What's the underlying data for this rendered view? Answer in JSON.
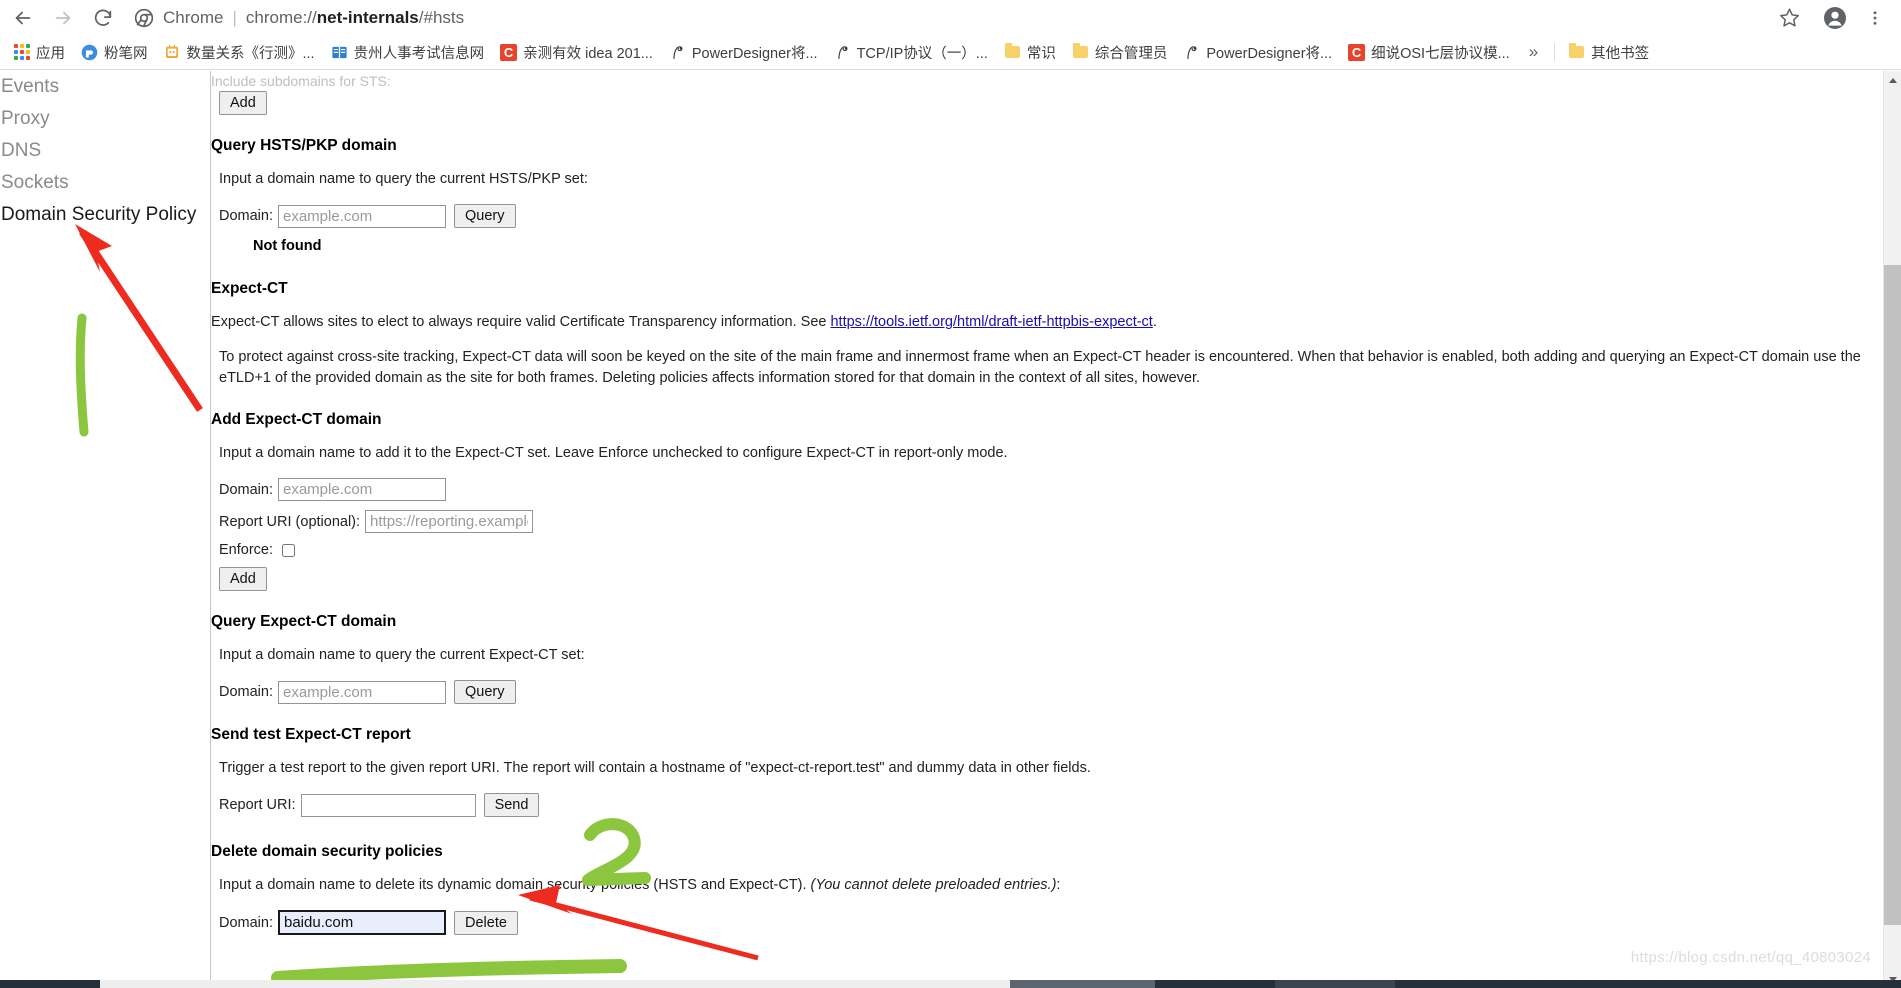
{
  "browser": {
    "nav": {
      "back_icon": "arrow-left-icon",
      "forward_icon": "arrow-right-icon",
      "reload_icon": "reload-icon"
    },
    "omnibox": {
      "chrome_icon": "chrome-icon",
      "chrome_label": "Chrome",
      "separator": "|",
      "url_prefix": "chrome://",
      "url_host": "net-internals",
      "url_suffix": "/#hsts",
      "full_url": "chrome://net-internals/#hsts"
    },
    "toolbar_icons": {
      "star": "star-icon",
      "avatar": "profile-avatar-icon",
      "menu": "three-dot-menu-icon"
    },
    "bookmarks": [
      {
        "label": "应用",
        "icon": "apps-grid-icon"
      },
      {
        "label": "粉笔网",
        "icon": "fenbi-icon"
      },
      {
        "label": "数量关系《行测》...",
        "icon": "book-icon"
      },
      {
        "label": "贵州人事考试信息网",
        "icon": "book-blue-icon"
      },
      {
        "label": "亲测有效 idea 201...",
        "icon": "csdn-c-icon"
      },
      {
        "label": "PowerDesigner将...",
        "icon": "pd-icon"
      },
      {
        "label": "TCP/IP协议（一）...",
        "icon": "pd-icon"
      },
      {
        "label": "常识",
        "icon": "folder-icon"
      },
      {
        "label": "综合管理员",
        "icon": "folder-icon"
      },
      {
        "label": "PowerDesigner将...",
        "icon": "pd-icon"
      },
      {
        "label": "细说OSI七层协议模...",
        "icon": "csdn-c-icon"
      }
    ],
    "bookmarks_overflow": "»",
    "other_bookmarks": {
      "label": "其他书签",
      "icon": "folder-icon"
    }
  },
  "sidebar": {
    "items": [
      {
        "label": "Events",
        "active": false
      },
      {
        "label": "Proxy",
        "active": false
      },
      {
        "label": "DNS",
        "active": false
      },
      {
        "label": "Sockets",
        "active": false
      },
      {
        "label": "Domain Security Policy",
        "active": true
      }
    ]
  },
  "main": {
    "cut_off_line": "Include subdomains for STS:",
    "add_sts_button": "Add",
    "query_hsts": {
      "heading": "Query HSTS/PKP domain",
      "description": "Input a domain name to query the current HSTS/PKP set:",
      "domain_label": "Domain:",
      "domain_placeholder": "example.com",
      "domain_value": "",
      "query_button": "Query",
      "result": "Not found"
    },
    "expect_ct": {
      "heading": "Expect-CT",
      "para1_before_link": "Expect-CT allows sites to elect to always require valid Certificate Transparency information. See ",
      "para1_link": "https://tools.ietf.org/html/draft-ietf-httpbis-expect-ct",
      "para1_after_link": ".",
      "para2": "To protect against cross-site tracking, Expect-CT data will soon be keyed on the site of the main frame and innermost frame when an Expect-CT header is encountered. When that behavior is enabled, both adding and querying an Expect-CT domain use the eTLD+1 of the provided domain as the site for both frames. Deleting policies affects information stored for that domain in the context of all sites, however."
    },
    "add_expect_ct": {
      "heading": "Add Expect-CT domain",
      "description": "Input a domain name to add it to the Expect-CT set. Leave Enforce unchecked to configure Expect-CT in report-only mode.",
      "domain_label": "Domain:",
      "domain_placeholder": "example.com",
      "domain_value": "",
      "report_uri_label": "Report URI (optional):",
      "report_uri_placeholder": "https://reporting.example.c",
      "report_uri_value": "",
      "enforce_label": "Enforce:",
      "enforce_checked": false,
      "add_button": "Add"
    },
    "query_expect_ct": {
      "heading": "Query Expect-CT domain",
      "description": "Input a domain name to query the current Expect-CT set:",
      "domain_label": "Domain:",
      "domain_placeholder": "example.com",
      "domain_value": "",
      "query_button": "Query"
    },
    "send_test_report": {
      "heading": "Send test Expect-CT report",
      "description": "Trigger a test report to the given report URI. The report will contain a hostname of \"expect-ct-report.test\" and dummy data in other fields.",
      "report_uri_label": "Report URI:",
      "report_uri_value": "",
      "send_button": "Send"
    },
    "delete_policies": {
      "heading": "Delete domain security policies",
      "description_plain": "Input a domain name to delete its dynamic domain security policies (HSTS and Expect-CT). ",
      "description_italic": "(You cannot delete preloaded entries.)",
      "description_tail": ":",
      "domain_label": "Domain:",
      "domain_value": "baidu.com",
      "delete_button": "Delete"
    }
  },
  "annotations": {
    "step1_label": "1",
    "step2_label": "2",
    "arrow1_target": "Domain Security Policy",
    "arrow2_target": "Delete domain security policies",
    "highlight_color": "#8cc63e",
    "arrow_color": "#ed2b1f"
  },
  "watermark": {
    "text": "https://blog.csdn.net/qq_40803024"
  }
}
